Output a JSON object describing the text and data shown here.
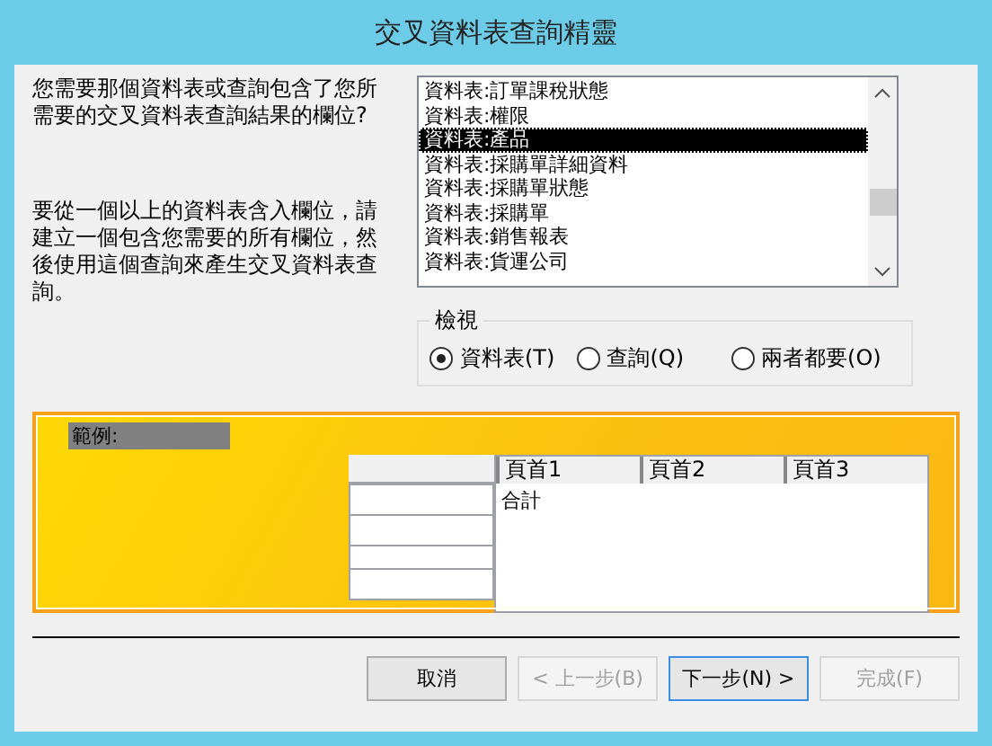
{
  "window": {
    "title": "交叉資料表查詢精靈"
  },
  "prompt": "您需要那個資料表或查詢包含了您所需要的交叉資料表查詢結果的欄位?",
  "hint": "要從一個以上的資料表含入欄位，請建立一個包含您需要的所有欄位，然後使用這個查詢來產生交叉資料表查詢。",
  "list": {
    "items": [
      {
        "label": "資料表:訂單課稅狀態",
        "selected": false
      },
      {
        "label": "資料表:權限",
        "selected": false
      },
      {
        "label": "資料表:產品",
        "selected": true
      },
      {
        "label": "資料表:採購單詳細資料",
        "selected": false
      },
      {
        "label": "資料表:採購單狀態",
        "selected": false
      },
      {
        "label": "資料表:採購單",
        "selected": false
      },
      {
        "label": "資料表:銷售報表",
        "selected": false
      },
      {
        "label": "資料表:貨運公司",
        "selected": false
      }
    ]
  },
  "view": {
    "title": "檢視",
    "options": [
      {
        "label": "資料表(T)",
        "selected": true
      },
      {
        "label": "查詢(Q)",
        "selected": false
      },
      {
        "label": "兩者都要(O)",
        "selected": false
      }
    ]
  },
  "sample": {
    "label": "範例:",
    "headers": [
      "頁首1",
      "頁首2",
      "頁首3"
    ],
    "cell": "合計"
  },
  "buttons": [
    {
      "label": "取消",
      "disabled": false,
      "default": false
    },
    {
      "label": "< 上一步(B)",
      "disabled": true,
      "default": false
    },
    {
      "label": "下一步(N) >",
      "disabled": false,
      "default": true
    },
    {
      "label": "完成(F)",
      "disabled": true,
      "default": false
    }
  ]
}
